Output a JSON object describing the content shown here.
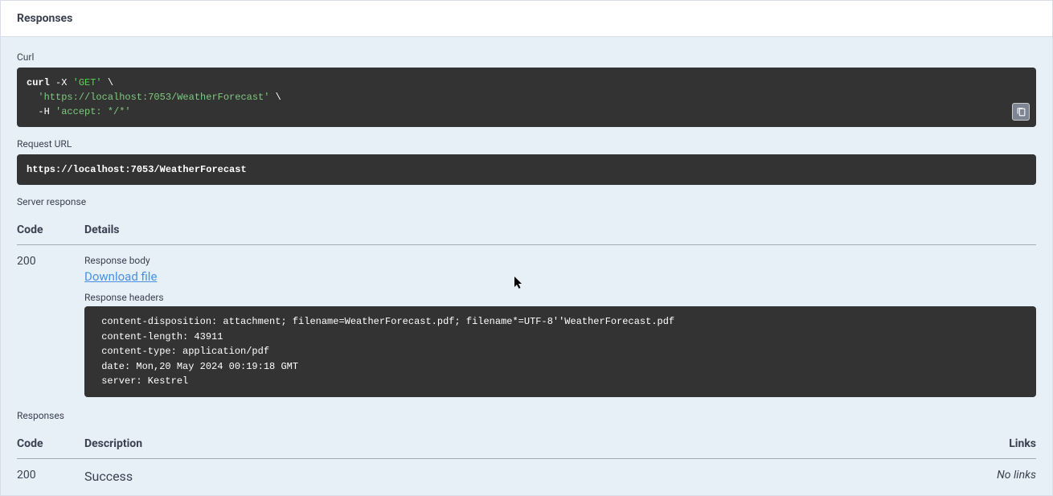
{
  "header": {
    "title": "Responses"
  },
  "curl": {
    "label": "Curl",
    "cmd": "curl",
    "flagX": " -X ",
    "method": "'GET'",
    "cont1": " \\",
    "indent1": "  ",
    "url": "'https://localhost:7053/WeatherForecast'",
    "cont2": " \\",
    "indent2": "  -H ",
    "accept": "'accept: */*'"
  },
  "request_url": {
    "label": "Request URL",
    "value": "https://localhost:7053/WeatherForecast"
  },
  "server_response": {
    "label": "Server response",
    "code_header": "Code",
    "details_header": "Details",
    "rows": [
      {
        "code": "200",
        "body_label": "Response body",
        "download_text": "Download file",
        "headers_label": "Response headers",
        "headers_text": " content-disposition: attachment; filename=WeatherForecast.pdf; filename*=UTF-8''WeatherForecast.pdf \n content-length: 43911 \n content-type: application/pdf \n date: Mon,20 May 2024 00:19:18 GMT \n server: Kestrel "
      }
    ]
  },
  "responses": {
    "label": "Responses",
    "code_header": "Code",
    "description_header": "Description",
    "links_header": "Links",
    "rows": [
      {
        "code": "200",
        "description": "Success",
        "links": "No links"
      }
    ]
  }
}
